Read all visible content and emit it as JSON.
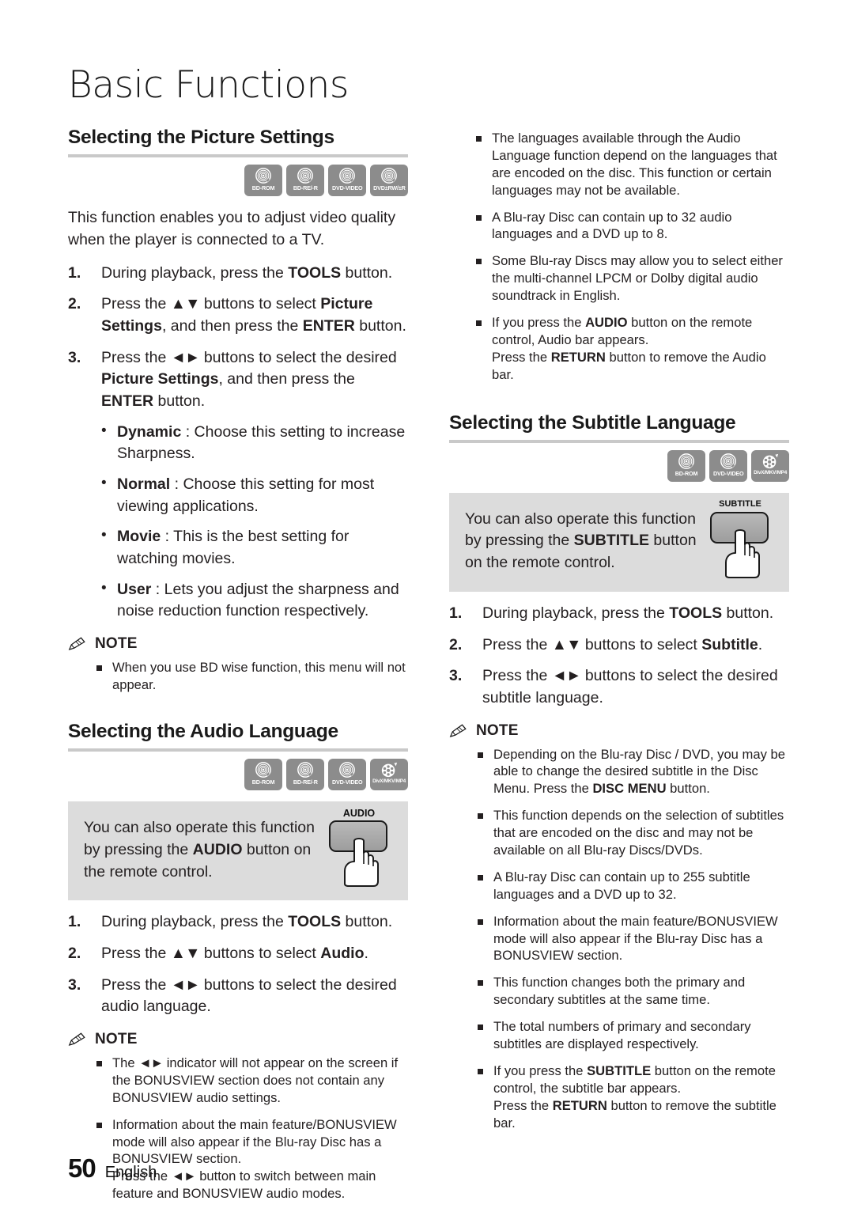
{
  "chapter": {
    "title": "Basic Functions"
  },
  "footer": {
    "page_number": "50",
    "language": "English"
  },
  "icons": {
    "note_pencil": "pencil-icon",
    "hand": "pointing-hand-icon"
  },
  "left_column": {
    "picture_settings": {
      "heading": "Selecting the Picture Settings",
      "discs": [
        {
          "label": "BD-ROM",
          "type": "disc"
        },
        {
          "label": "BD-RE/-R",
          "type": "disc"
        },
        {
          "label": "DVD-VIDEO",
          "type": "disc"
        },
        {
          "label": "DVD±RW/±R",
          "type": "disc"
        }
      ],
      "intro": "This function enables you to adjust video quality when the player is connected to a TV.",
      "steps": [
        {
          "num": "1.",
          "html": "During playback, press the <strong>TOOLS</strong> button."
        },
        {
          "num": "2.",
          "html": "Press the <span class=\"arrowpair\">▲▼</span> buttons to select <strong>Picture Settings</strong>, and then press the <strong>ENTER</strong> button."
        },
        {
          "num": "3.",
          "html": "Press the <span class=\"arrowpair\">◄►</span> buttons to select the desired <strong>Picture Settings</strong>, and then press the <strong>ENTER</strong> button."
        }
      ],
      "options": [
        {
          "html": "<strong>Dynamic</strong> : Choose this setting to increase Sharpness."
        },
        {
          "html": "<strong>Normal</strong> : Choose this setting for most viewing applications."
        },
        {
          "html": "<strong>Movie</strong> : This is the best setting for watching movies."
        },
        {
          "html": "<strong>User</strong> : Lets you adjust the sharpness and noise reduction function respectively."
        }
      ],
      "note_label": "NOTE",
      "notes": [
        {
          "html": "When you use BD wise function, this menu will not appear."
        }
      ]
    },
    "audio_language": {
      "heading": "Selecting the Audio Language",
      "discs": [
        {
          "label": "BD-ROM",
          "type": "disc"
        },
        {
          "label": "BD-RE/-R",
          "type": "disc"
        },
        {
          "label": "DVD-VIDEO",
          "type": "disc"
        },
        {
          "label": "DivX/MKV/MP4",
          "type": "film"
        }
      ],
      "callout": {
        "html": "You can also operate this function by pressing the <strong>AUDIO</strong> button on the remote control.",
        "button_label": "AUDIO"
      },
      "steps": [
        {
          "num": "1.",
          "html": "During playback, press the <strong>TOOLS</strong> button."
        },
        {
          "num": "2.",
          "html": "Press the <span class=\"arrowpair\">▲▼</span> buttons to select <strong>Audio</strong>."
        },
        {
          "num": "3.",
          "html": "Press the <span class=\"arrowpair\">◄►</span> buttons to select the desired audio language."
        }
      ],
      "note_label": "NOTE",
      "notes": [
        {
          "html": "The <span class=\"arrowpair\">◄►</span> indicator will not appear on the screen if the BONUSVIEW section does not contain any BONUSVIEW audio settings."
        },
        {
          "html": "Information about the main feature/BONUSVIEW mode will also appear if the Blu-ray Disc has a BONUSVIEW section.<br>Press the <span class=\"arrowpair\">◄►</span> button to switch between main feature and BONUSVIEW audio modes."
        }
      ]
    }
  },
  "right_column": {
    "audio_notes_continued": [
      {
        "html": "The languages available through the Audio Language function depend on the languages that are encoded on the disc. This function or certain languages may not be available."
      },
      {
        "html": "A Blu-ray Disc can contain up to 32 audio languages and a DVD up to 8."
      },
      {
        "html": "Some Blu-ray Discs may allow you to select either the multi-channel LPCM or Dolby digital audio soundtrack in English."
      },
      {
        "html": "If you press the <strong>AUDIO</strong> button on the remote control, Audio bar appears.<br>Press the <strong>RETURN</strong> button to remove the Audio bar."
      }
    ],
    "subtitle_language": {
      "heading": "Selecting the Subtitle Language",
      "discs": [
        {
          "label": "BD-ROM",
          "type": "disc"
        },
        {
          "label": "DVD-VIDEO",
          "type": "disc"
        },
        {
          "label": "DivX/MKV/MP4",
          "type": "film"
        }
      ],
      "callout": {
        "html": "You can also operate this function by pressing the <strong>SUBTITLE</strong> button on the remote control.",
        "button_label": "SUBTITLE"
      },
      "steps": [
        {
          "num": "1.",
          "html": "During playback, press the <strong>TOOLS</strong> button."
        },
        {
          "num": "2.",
          "html": "Press the <span class=\"arrowpair\">▲▼</span> buttons to select <strong>Subtitle</strong>."
        },
        {
          "num": "3.",
          "html": "Press the <span class=\"arrowpair\">◄►</span> buttons to select the desired subtitle language."
        }
      ],
      "note_label": "NOTE",
      "notes": [
        {
          "html": "Depending on the Blu-ray Disc / DVD, you may be able to change the desired subtitle in the Disc Menu. Press the <strong>DISC MENU</strong> button."
        },
        {
          "html": "This function depends on the selection of subtitles that are encoded on the disc and may not be available on all Blu-ray Discs/DVDs."
        },
        {
          "html": "A Blu-ray Disc can contain up to 255 subtitle languages and a DVD up to 32."
        },
        {
          "html": "Information about the main feature/BONUSVIEW mode will also appear if the Blu-ray Disc has a BONUSVIEW section."
        },
        {
          "html": "This function changes both the primary and secondary subtitles at the same time."
        },
        {
          "html": "The total numbers of primary and secondary subtitles are displayed respectively."
        },
        {
          "html": "If you press the <strong>SUBTITLE</strong> button on the remote control, the subtitle bar appears.<br>Press the <strong>RETURN</strong> button to remove the subtitle bar."
        }
      ]
    }
  }
}
